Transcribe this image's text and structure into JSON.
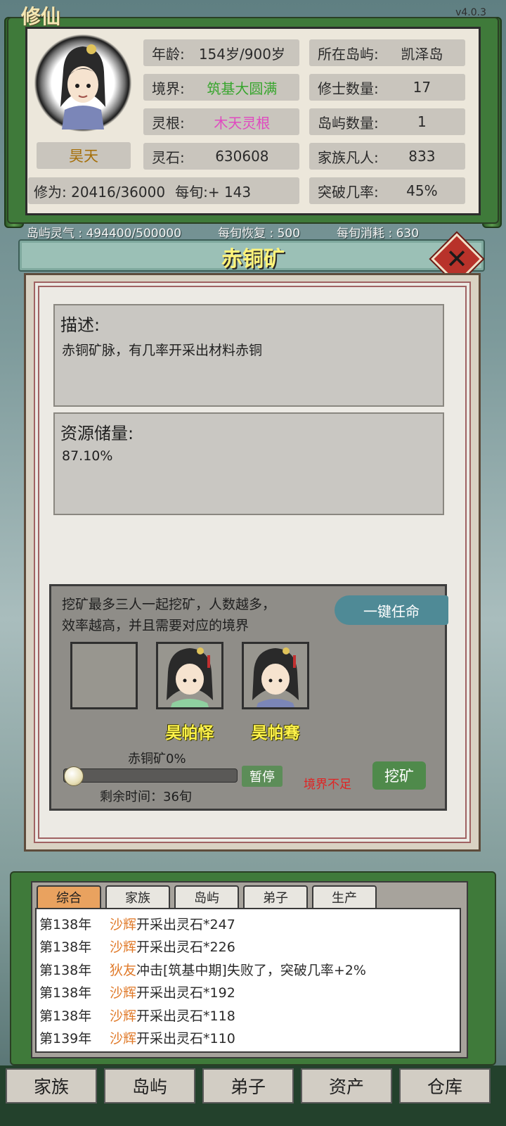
{
  "header": {
    "game_title": "修仙",
    "version": "v4.0.3"
  },
  "character": {
    "name": "昊天",
    "age_label": "年龄:",
    "age_value": "154岁/900岁",
    "realm_label": "境界:",
    "realm_value": "筑基大圆满",
    "root_label": "灵根:",
    "root_value": "木天灵根",
    "stones_label": "灵石:",
    "stones_value": "630608",
    "cultivation_text": "修为: 20416/36000",
    "per_turn_text": "每旬:+ 143",
    "island_label": "所在岛屿:",
    "island_value": "凯泽岛",
    "cultivators_label": "修士数量:",
    "cultivators_value": "17",
    "islands_label": "岛屿数量:",
    "islands_value": "1",
    "mortals_label": "家族凡人:",
    "mortals_value": "833",
    "breakthrough_label": "突破几率:",
    "breakthrough_value": "45%"
  },
  "aura": {
    "island_aura": "岛屿灵气 : 494400/500000",
    "recovery": "每旬恢复 : 500",
    "consumption": "每旬消耗 : 630"
  },
  "mine": {
    "title": "赤铜矿",
    "close_symbol": "✕",
    "desc_title": "描述:",
    "desc_text": "赤铜矿脉，有几率开采出材料赤铜",
    "reserve_title": "资源储量:",
    "reserve_value": "87.10%",
    "mining_desc_line1": "挖矿最多三人一起挖矿，人数越多，",
    "mining_desc_line2": "效率越高，并且需要对应的境界",
    "appoint_button": "一键任命",
    "slots": [
      {
        "name": ""
      },
      {
        "name": "昊帕怿"
      },
      {
        "name": "昊帕骞"
      }
    ],
    "progress_label": "赤铜矿0%",
    "progress_value": 0,
    "pause_button": "暂停",
    "warning": "境界不足",
    "mine_button": "挖矿",
    "remaining_time": "剩余时间：36旬"
  },
  "log": {
    "tabs": [
      "综合",
      "家族",
      "岛屿",
      "弟子",
      "生产"
    ],
    "active_tab": 0,
    "entries": [
      {
        "year": "第138年",
        "name": "沙辉",
        "text": "开采出灵石*247"
      },
      {
        "year": "第138年",
        "name": "沙辉",
        "text": "开采出灵石*226"
      },
      {
        "year": "第138年",
        "name": "狄友",
        "text": "冲击[筑基中期]失败了，突破几率+2%"
      },
      {
        "year": "第138年",
        "name": "沙辉",
        "text": "开采出灵石*192"
      },
      {
        "year": "第138年",
        "name": "沙辉",
        "text": "开采出灵石*118"
      },
      {
        "year": "第139年",
        "name": "沙辉",
        "text": "开采出灵石*110"
      }
    ]
  },
  "nav": [
    "家族",
    "岛屿",
    "弟子",
    "资产",
    "仓库"
  ],
  "colors": {
    "realm_green": "#37a52d",
    "root_pink": "#e04ac0",
    "title_yellow": "#fff37a",
    "warning_red": "#e02424",
    "active_tab": "#e9a25f"
  }
}
